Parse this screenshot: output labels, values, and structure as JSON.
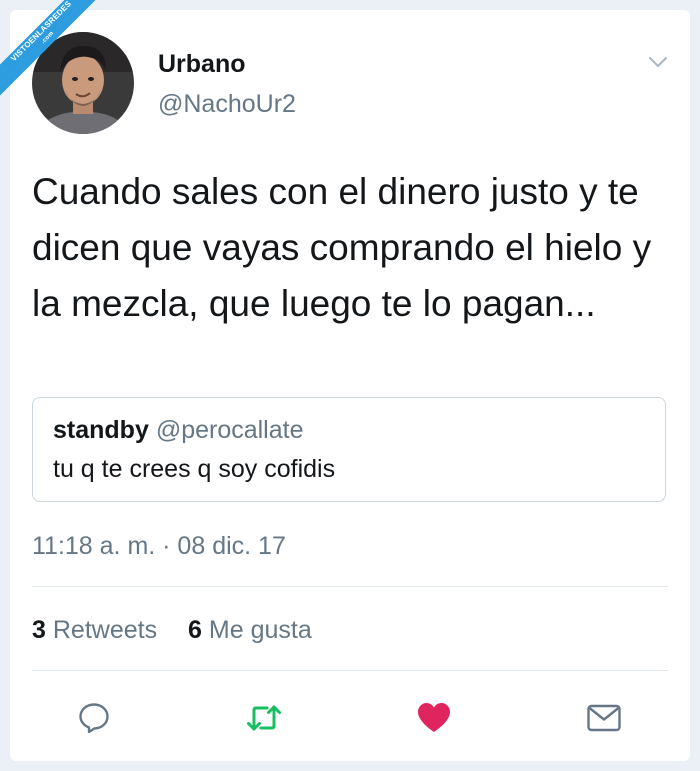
{
  "watermark": {
    "line1": "VISTOENLASREDES",
    "line2": ".com"
  },
  "author": {
    "name": "Urbano",
    "handle": "@NachoUr2"
  },
  "tweet": {
    "text": "Cuando sales con el dinero justo y te dicen que vayas comprando el hielo y la mezcla, que luego te lo pagan..."
  },
  "quoted": {
    "name": "standby",
    "handle": "@perocallate",
    "text": "tu q te crees q soy cofidis"
  },
  "timestamp": "11:18 a. m. · 08 dic. 17",
  "stats": {
    "retweets_count": "3",
    "retweets_label": "Retweets",
    "likes_count": "6",
    "likes_label": "Me gusta"
  },
  "colors": {
    "retweet_active": "#17bf63",
    "like_active": "#e0245e",
    "muted_icon": "#657786",
    "badge": "#2d9de0"
  },
  "icons": [
    "reply-icon",
    "retweet-icon",
    "like-icon",
    "direct-message-icon",
    "chevron-down-icon"
  ]
}
